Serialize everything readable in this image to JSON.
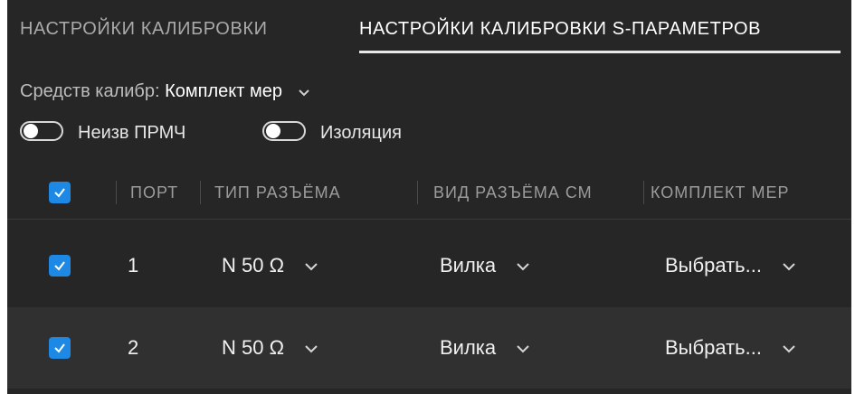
{
  "tabs": [
    {
      "label": "НАСТРОЙКИ КАЛИБРОВКИ",
      "active": false
    },
    {
      "label": "НАСТРОЙКИ КАЛИБРОВКИ S-ПАРАМЕТРОВ",
      "active": true
    }
  ],
  "calibration": {
    "label": "Средств калибр:",
    "value": "Комплект мер"
  },
  "toggles": [
    {
      "label": "Неизв ПРМЧ",
      "on": false
    },
    {
      "label": "Изоляция",
      "on": false
    }
  ],
  "table": {
    "header_checked": true,
    "columns": [
      "ПОРТ",
      "ТИП РАЗЪЁМА",
      "ВИД РАЗЪЁМА СМ",
      "КОМПЛЕКТ МЕР"
    ],
    "rows": [
      {
        "checked": true,
        "port": "1",
        "connector_type": "N 50 Ω",
        "connector_kind": "Вилка",
        "kit": "Выбрать..."
      },
      {
        "checked": true,
        "port": "2",
        "connector_type": "N 50 Ω",
        "connector_kind": "Вилка",
        "kit": "Выбрать..."
      }
    ]
  },
  "colors": {
    "accent": "#1e88e5",
    "background": "#262626",
    "row_alt": "#303030"
  }
}
